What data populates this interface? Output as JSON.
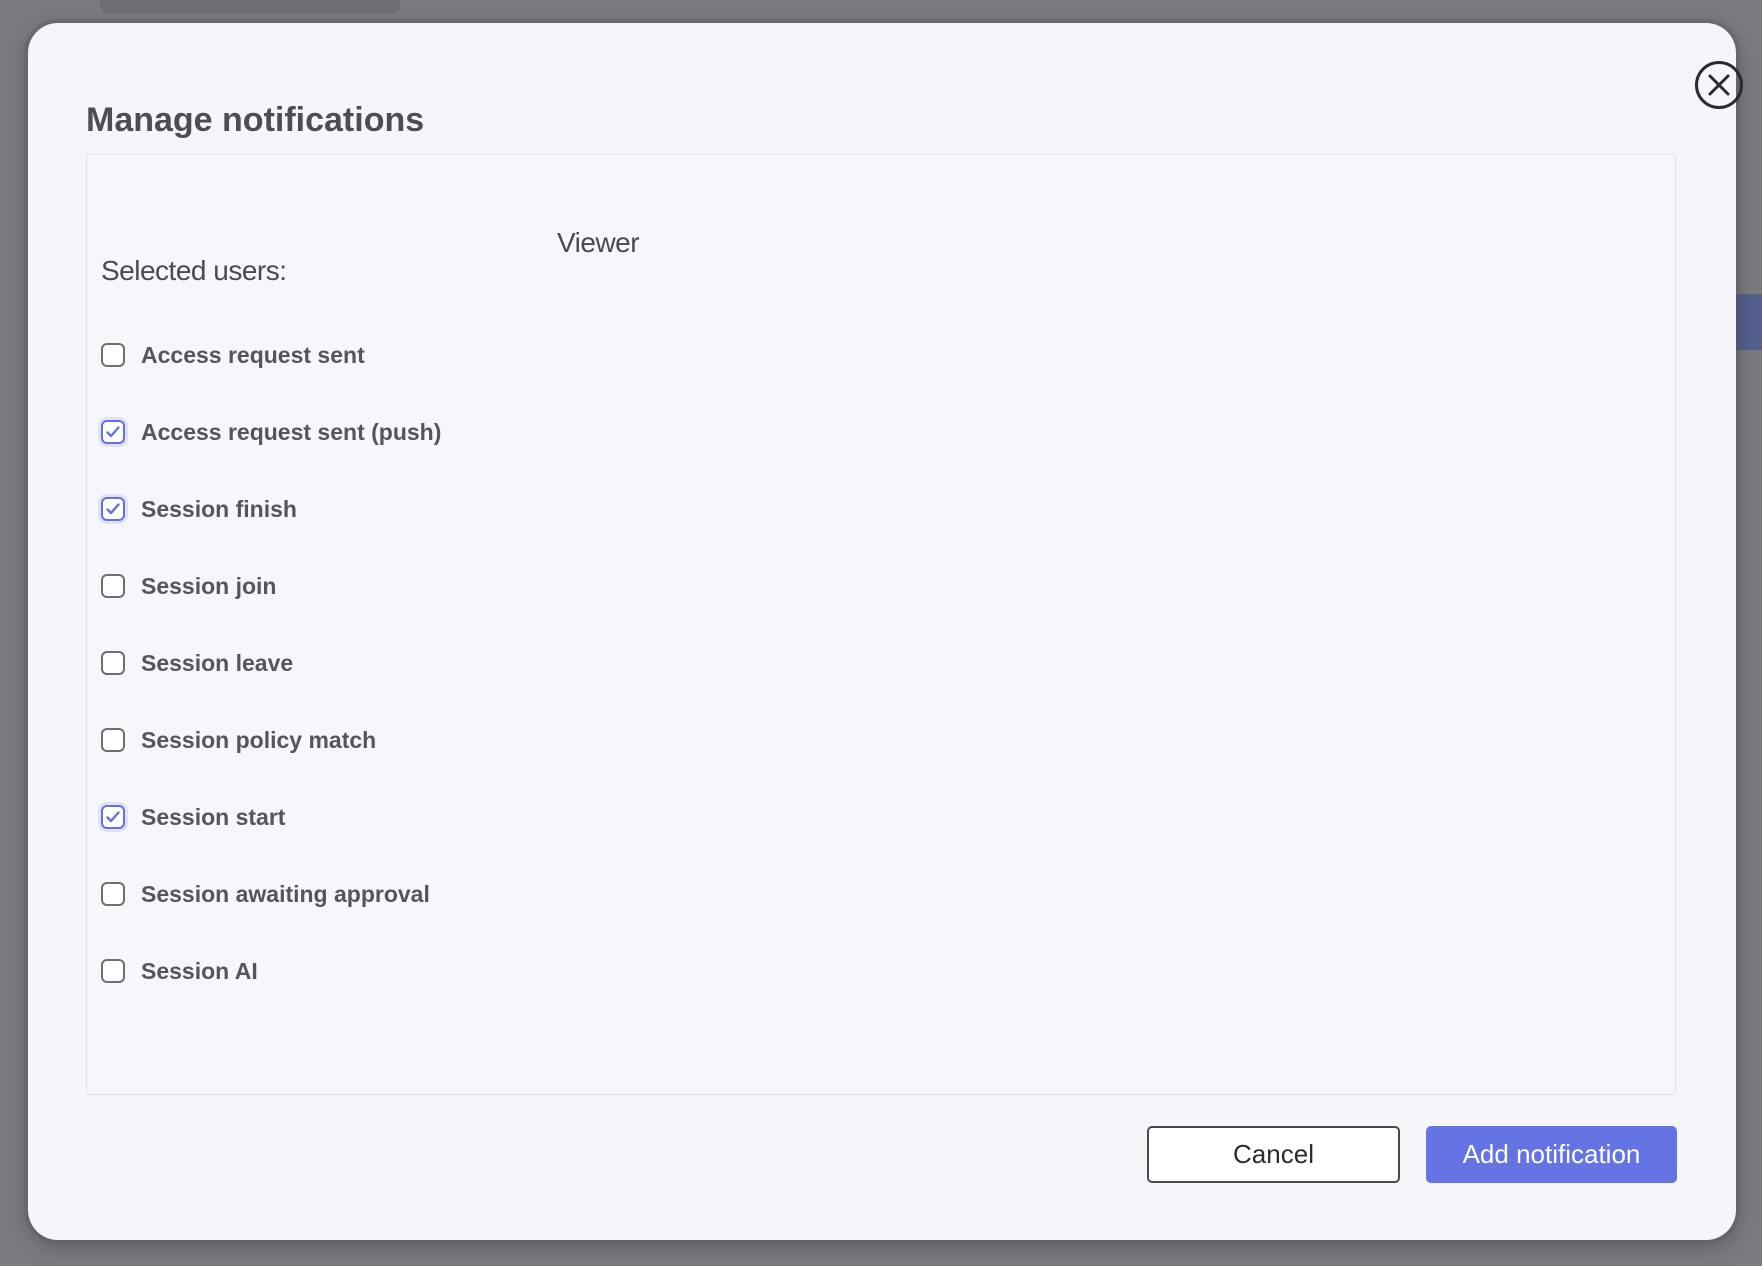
{
  "modal": {
    "title": "Manage notifications",
    "close_icon": "close-circle-icon"
  },
  "users": {
    "label": "Selected users:",
    "value": "Viewer"
  },
  "notifications": [
    {
      "label": "Access request sent",
      "checked": false
    },
    {
      "label": "Access request sent (push)",
      "checked": true
    },
    {
      "label": "Session finish",
      "checked": true
    },
    {
      "label": "Session join",
      "checked": false
    },
    {
      "label": "Session leave",
      "checked": false
    },
    {
      "label": "Session policy match",
      "checked": false
    },
    {
      "label": "Session start",
      "checked": true
    },
    {
      "label": "Session awaiting approval",
      "checked": false
    },
    {
      "label": "Session AI",
      "checked": false
    }
  ],
  "footer": {
    "cancel_label": "Cancel",
    "add_label": "Add notification"
  },
  "colors": {
    "accent": "#6474e5",
    "checkbox_checked": "#6471e6",
    "modal_background": "#f5f5fa"
  }
}
